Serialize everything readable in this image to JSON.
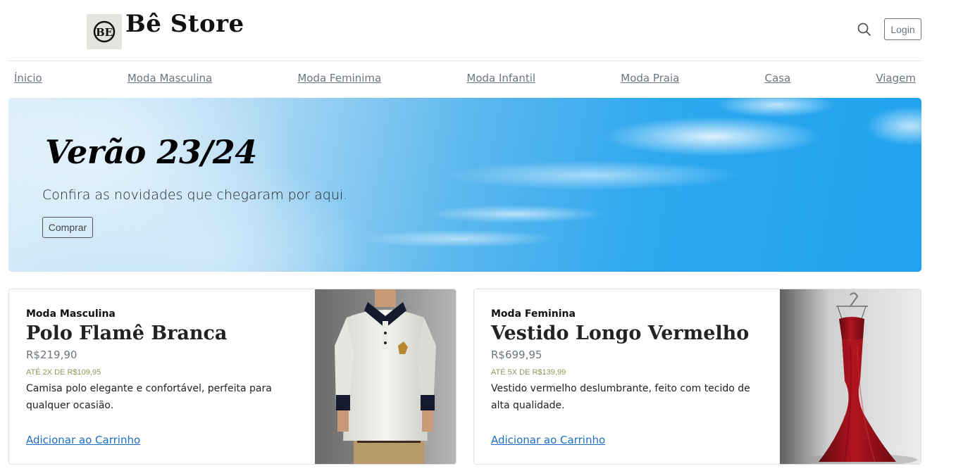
{
  "header": {
    "brand": "Bê Store",
    "logo_icon": "store-monogram-icon",
    "search_icon": "search-icon",
    "login_label": "Login"
  },
  "nav": {
    "items": [
      {
        "label": "Ínicio"
      },
      {
        "label": "Moda Masculina"
      },
      {
        "label": "Moda Feminima"
      },
      {
        "label": "Moda Infantil"
      },
      {
        "label": "Moda Praia"
      },
      {
        "label": "Casa"
      },
      {
        "label": "Viagem"
      }
    ]
  },
  "hero": {
    "title": "Verão 23/24",
    "subtitle": "Confira as novidades que chegaram por aqui.",
    "button_label": "Comprar"
  },
  "products": [
    {
      "category": "Moda Masculina",
      "title": "Polo Flamê Branca",
      "price": "R$219,90",
      "installments": "ATÉ 2X DE R$109,95",
      "description": "Camisa polo elegante e confortável, perfeita para qualquer ocasião.",
      "cta": "Adicionar ao Carrinho",
      "image": "white-polo-shirt-photo"
    },
    {
      "category": "Moda Feminina",
      "title": "Vestido Longo Vermelho",
      "price": "R$699,95",
      "installments": "ATÉ 5X DE R$139,99",
      "description": "Vestido vermelho deslumbrante, feito com tecido de alta qualidade.",
      "cta": "Adicionar ao Carrinho",
      "image": "red-long-dress-photo"
    }
  ],
  "colors": {
    "accent_link": "#1a6fc4",
    "muted": "#6c757d",
    "installments": "#8a9a5b",
    "sky": "#2ea8ef",
    "dress_red": "#a3121c"
  }
}
